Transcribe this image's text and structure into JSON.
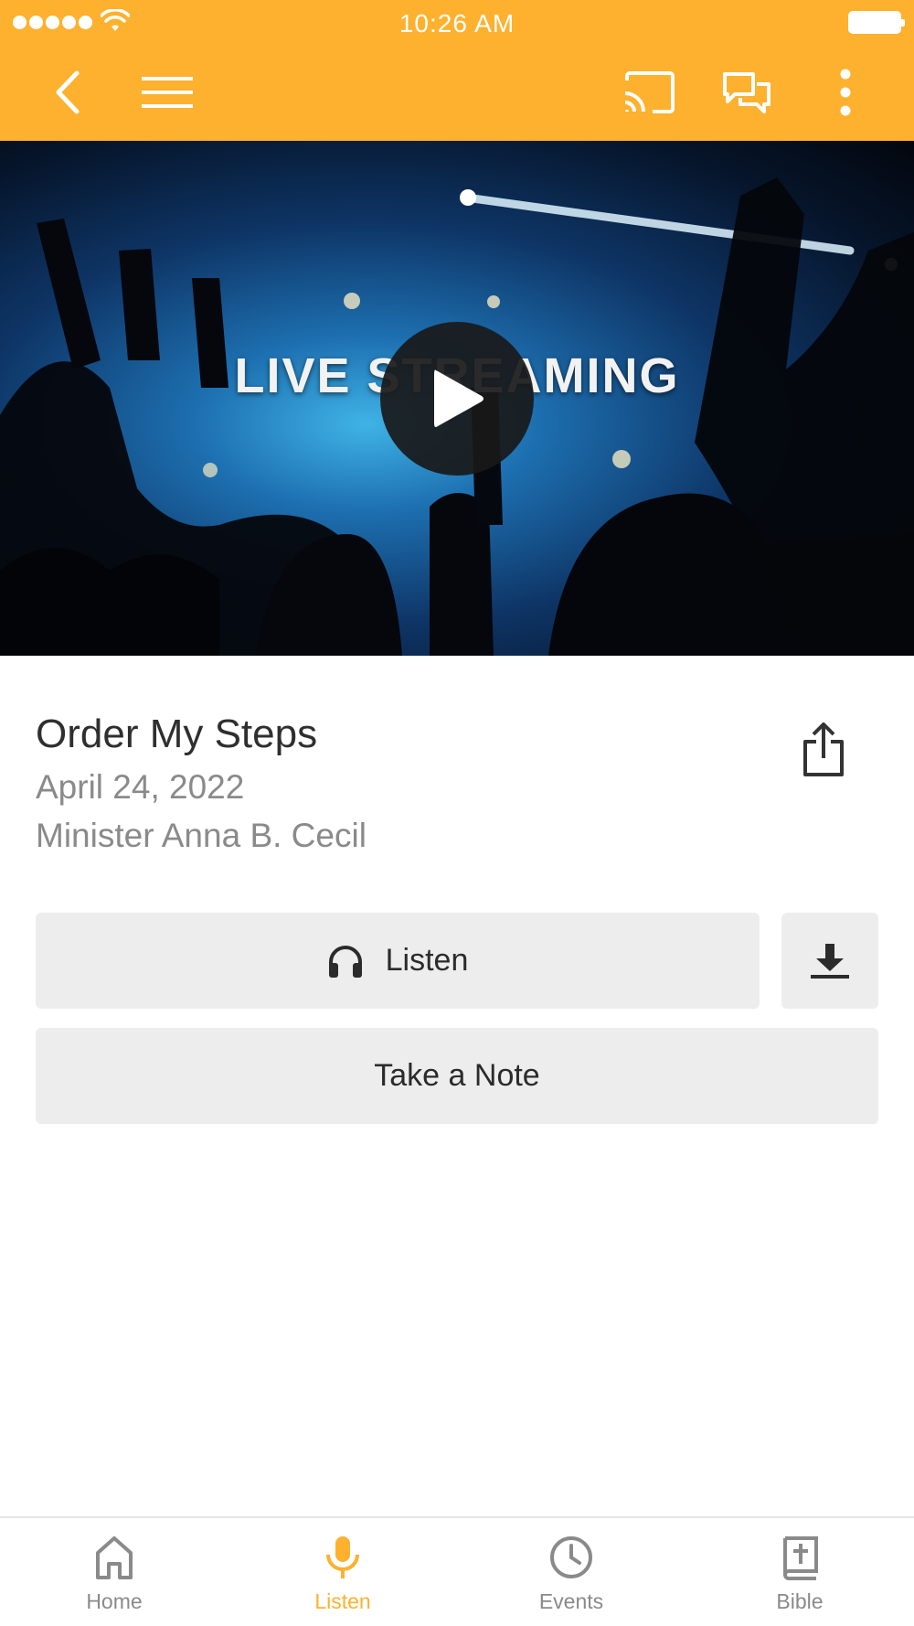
{
  "status_bar": {
    "time": "10:26 AM"
  },
  "navbar": {
    "icons": [
      "back-icon",
      "menu-icon",
      "cast-icon",
      "chat-icon",
      "more-vertical-icon"
    ]
  },
  "colors": {
    "accent": "#fdb12e",
    "button_bg": "#ededee",
    "muted_text": "#8a8a8a"
  },
  "video": {
    "overlay_text": "LIVE STREAMING",
    "icon": "play-icon"
  },
  "sermon": {
    "title": "Order My Steps",
    "date": "April 24, 2022",
    "speaker": "Minister Anna B. Cecil"
  },
  "actions": {
    "listen_label": "Listen",
    "note_label": "Take a Note",
    "download_icon": "download-icon",
    "share_icon": "share-icon"
  },
  "tabs": [
    {
      "label": "Home",
      "icon": "home-icon",
      "active": false
    },
    {
      "label": "Listen",
      "icon": "microphone-icon",
      "active": true
    },
    {
      "label": "Events",
      "icon": "clock-icon",
      "active": false
    },
    {
      "label": "Bible",
      "icon": "bible-icon",
      "active": false
    }
  ]
}
